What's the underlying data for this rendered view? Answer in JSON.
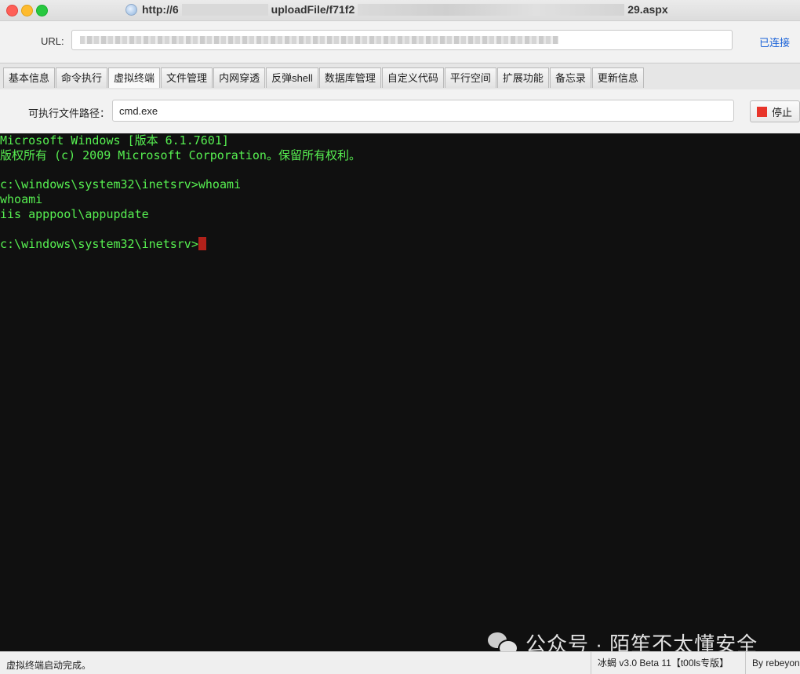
{
  "window": {
    "title_prefix": "http://6",
    "title_mid": "uploadFile/f71f2",
    "title_suffix": "29.aspx"
  },
  "url_bar": {
    "label": "URL:",
    "connection_status": "已连接"
  },
  "tabs": [
    {
      "label": "基本信息",
      "active": false
    },
    {
      "label": "命令执行",
      "active": false
    },
    {
      "label": "虚拟终端",
      "active": true
    },
    {
      "label": "文件管理",
      "active": false
    },
    {
      "label": "内网穿透",
      "active": false
    },
    {
      "label": "反弹shell",
      "active": false
    },
    {
      "label": "数据库管理",
      "active": false
    },
    {
      "label": "自定义代码",
      "active": false
    },
    {
      "label": "平行空间",
      "active": false
    },
    {
      "label": "扩展功能",
      "active": false
    },
    {
      "label": "备忘录",
      "active": false
    },
    {
      "label": "更新信息",
      "active": false
    }
  ],
  "exec_path": {
    "label": "可执行文件路径：",
    "value": "cmd.exe",
    "stop_label": "停止"
  },
  "terminal": {
    "lines": [
      "Microsoft Windows [版本 6.1.7601]",
      "版权所有 (c) 2009 Microsoft Corporation。保留所有权利。",
      "",
      "c:\\windows\\system32\\inetsrv>whoami",
      "whoami",
      "iis apppool\\appupdate",
      ""
    ],
    "prompt": "c:\\windows\\system32\\inetsrv>"
  },
  "watermark": {
    "text": "公众号 · 陌笙不太懂安全"
  },
  "status_bar": {
    "message": "虚拟终端启动完成。",
    "version": "冰蝎 v3.0 Beta 11【t00ls专版】",
    "author": "By rebeyond"
  },
  "colors": {
    "terminal_bg": "#101010",
    "terminal_fg": "#57f051",
    "cursor": "#b1211a",
    "stop_icon": "#e8352a",
    "link": "#1a62d8"
  }
}
